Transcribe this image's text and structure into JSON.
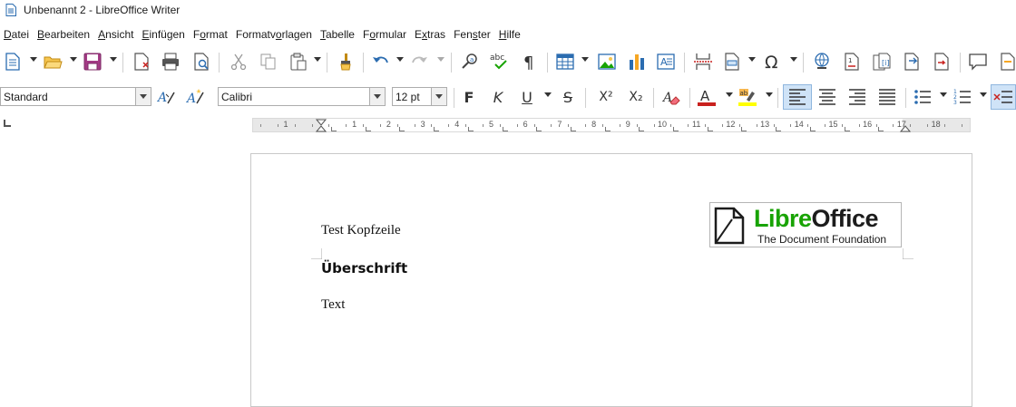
{
  "window": {
    "title": "Unbenannt 2 - LibreOffice Writer",
    "app_icon": "writer-document-icon"
  },
  "menu": [
    {
      "prefix": "",
      "key": "D",
      "rest": "atei"
    },
    {
      "prefix": "",
      "key": "B",
      "rest": "earbeiten"
    },
    {
      "prefix": "",
      "key": "A",
      "rest": "nsicht"
    },
    {
      "prefix": "",
      "key": "E",
      "rest": "infügen"
    },
    {
      "prefix": "F",
      "key": "o",
      "rest": "rmat"
    },
    {
      "prefix": "Formatv",
      "key": "o",
      "rest": "rlagen"
    },
    {
      "prefix": "",
      "key": "T",
      "rest": "abelle"
    },
    {
      "prefix": "F",
      "key": "o",
      "rest": "rmular"
    },
    {
      "prefix": "E",
      "key": "x",
      "rest": "tras"
    },
    {
      "prefix": "Fen",
      "key": "s",
      "rest": "ter"
    },
    {
      "prefix": "",
      "key": "H",
      "rest": "ilfe"
    }
  ],
  "formatting": {
    "paragraph_style": "Standard",
    "font_name": "Calibri",
    "font_size": "12 pt",
    "bold_label": "F",
    "italic_label": "K",
    "underline_label": "U",
    "strike_label": "S",
    "superscript_label": "X²",
    "subscript_label": "X₂"
  },
  "ruler": {
    "numbers": [
      "1",
      "1",
      "2",
      "3",
      "4",
      "5",
      "6",
      "7",
      "8",
      "9",
      "10",
      "11",
      "12",
      "13",
      "14",
      "15",
      "16",
      "17",
      "18"
    ]
  },
  "document": {
    "header_text": "Test Kopfzeile",
    "heading": "Überschrift",
    "body": "Text",
    "logo_word_green": "Libre",
    "logo_word_dark": "Office",
    "logo_tagline": "The Document Foundation"
  },
  "colors": {
    "accent": "#3a7fc4",
    "font_color_bar": "#c9211e",
    "highlight_bar": "#ffff00",
    "logo_green": "#18a303",
    "logo_dark": "#1c1c1c"
  }
}
